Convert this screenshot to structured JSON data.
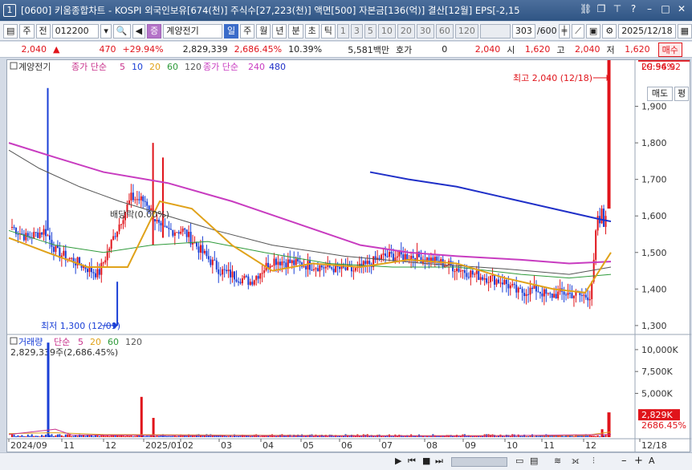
{
  "title": {
    "number": "1",
    "text": "[0600] 키움종합차트 - KOSPI 외국인보유[674(천)] 주식수[27,223(천)] 액면[500] 자본금[136(억)] 결산[12월] EPS[-2,15"
  },
  "toolbar": {
    "type1": "주",
    "type2": "전",
    "code": "012200",
    "stock_name": "계양전기",
    "periods": [
      "일",
      "주",
      "월",
      "년",
      "분",
      "초",
      "틱"
    ],
    "minutes": [
      "1",
      "3",
      "5",
      "10",
      "20",
      "30",
      "60",
      "120"
    ],
    "count": "303",
    "count_max": "/600",
    "date": "2025/12/18"
  },
  "info": {
    "price": "2,040",
    "change": "470",
    "change_pct": "+29.94%",
    "volume": "2,829,339",
    "volume_pct": "2,686.45%",
    "turnover": "10.39%",
    "amount": "5,581백만",
    "quote_label": "호가",
    "quote_val": "0",
    "quote_price": "2,040",
    "open_label": "시",
    "open_val": "1,620",
    "high_label": "고",
    "high_val": "2,040",
    "low_label": "저",
    "low_val": "1,620",
    "buy_label": "매수",
    "sell_label": "매도",
    "eval_label": "평"
  },
  "legend": {
    "stock_name": "계양전기",
    "ma_label": "종가 단순",
    "ma_periods": [
      "5",
      "10",
      "20",
      "60",
      "120"
    ],
    "ma2_label": "종가 단순",
    "ma2_periods": [
      "240",
      "480"
    ],
    "vol_label": "거래량",
    "vol_ma_label": "단순",
    "vol_ma_periods": [
      "5",
      "20",
      "60",
      "120"
    ],
    "vol_value": "2,829,339주(2,686.45%)"
  },
  "annotations": {
    "high": "최고 2,040 (12/18)",
    "low": "최저 1,300 (12/09)",
    "dividend": "배당락(0.00%)",
    "lc": "LC:56.92",
    "cur_price": "2,040",
    "cur_pct": "29.94%",
    "vol_cur": "2,829K",
    "vol_pct": "2686.45%"
  },
  "price_axis": [
    "1,900",
    "1,800",
    "1,700",
    "1,600",
    "1,500",
    "1,400",
    "1,300"
  ],
  "volume_axis": [
    "10,000K",
    "7,500K",
    "5,000K"
  ],
  "time_axis": [
    "2024/09",
    "11",
    "12",
    "2025/01",
    "02",
    "03",
    "04",
    "05",
    "06",
    "07",
    "08",
    "09",
    "10",
    "11",
    "12",
    "12/18"
  ],
  "colors": {
    "up": "#e0141b",
    "down": "#1a3fd6",
    "ma5": "#c8328c",
    "ma10": "#1a3fd6",
    "ma20": "#e0a21a",
    "ma60": "#2e9a3a",
    "ma120": "#555555",
    "ma240": "#c83cc0",
    "ma480": "#2030c8"
  }
}
